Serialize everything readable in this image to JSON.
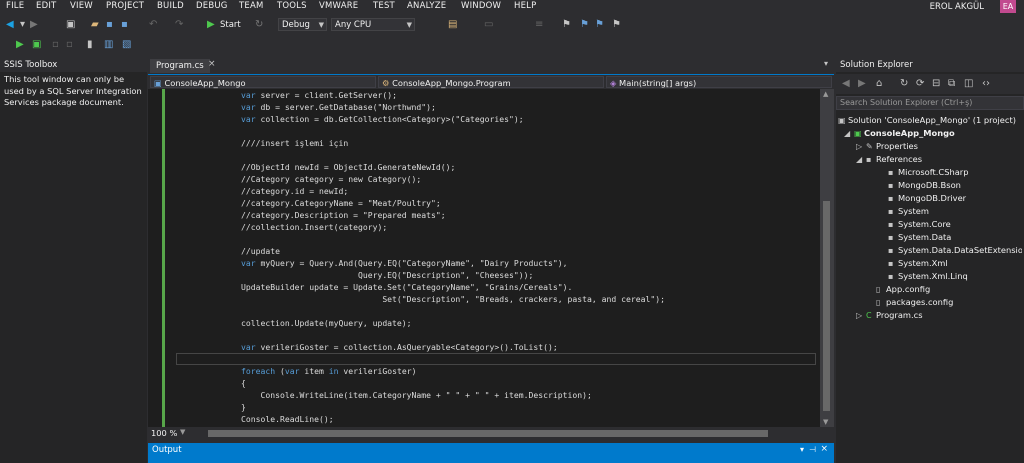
{
  "menu": [
    "FILE",
    "EDIT",
    "VIEW",
    "PROJECT",
    "BUILD",
    "DEBUG",
    "TEAM",
    "TOOLS",
    "VMWARE",
    "TEST",
    "ANALYZE",
    "WINDOW",
    "HELP"
  ],
  "user": {
    "name": "EROL AKGÜL",
    "initials": "EA"
  },
  "toolbar": {
    "start_label": "Start",
    "config": "Debug",
    "platform": "Any CPU"
  },
  "ssis": {
    "title": "SSIS Toolbox",
    "message": "This tool window can only be used by a SQL Server Integration Services package document."
  },
  "editor": {
    "tab": "Program.cs",
    "nav": {
      "project": "ConsoleApp_Mongo",
      "class": "ConsoleApp_Mongo.Program",
      "member": "Main(string[] args)"
    },
    "zoom": "100 %"
  },
  "output": {
    "title": "Output"
  },
  "solution_explorer": {
    "title": "Solution Explorer",
    "search_placeholder": "Search Solution Explorer (Ctrl+ş)",
    "items": [
      "Solution 'ConsoleApp_Mongo' (1 project)",
      "ConsoleApp_Mongo",
      "Properties",
      "References",
      "Microsoft.CSharp",
      "MongoDB.Bson",
      "MongoDB.Driver",
      "System",
      "System.Core",
      "System.Data",
      "System.Data.DataSetExtensions",
      "System.Xml",
      "System.Xml.Linq",
      "App.config",
      "packages.config",
      "Program.cs"
    ]
  },
  "code_lines": [
    "var server = client.GetServer();",
    "var db = server.GetDatabase(\"Northwnd\");",
    "var collection = db.GetCollection<Category>(\"Categories\");",
    "",
    "////insert işlemi için",
    "",
    "//ObjectId newId = ObjectId.GenerateNewId();",
    "//Category category = new Category();",
    "//category.id = newId;",
    "//category.CategoryName = \"Meat/Poultry\";",
    "//category.Description = \"Prepared meats\";",
    "//collection.Insert(category);",
    "",
    "//update",
    "var myQuery = Query.And(Query.EQ(\"CategoryName\", \"Dairy Products\"),",
    "                        Query.EQ(\"Description\", \"Cheeses\"));",
    "UpdateBuilder update = Update.Set(\"CategoryName\", \"Grains/Cereals\").",
    "                             Set(\"Description\", \"Breads, crackers, pasta, and cereal\");",
    "",
    "collection.Update(myQuery, update);",
    "",
    "var verileriGoster = collection.AsQueryable<Category>().ToList();",
    "",
    "foreach (var item in verileriGoster)",
    "{",
    "    Console.WriteLine(item.CategoryName + \" \" + \" \" + item.Description);",
    "}",
    "Console.ReadLine();"
  ]
}
